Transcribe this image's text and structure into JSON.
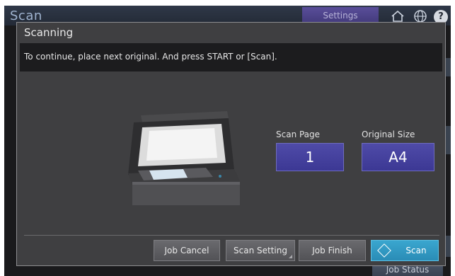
{
  "topbar": {
    "title": "Scan",
    "settings_label": "Settings",
    "icons": [
      "home-icon",
      "globe-icon",
      "help-icon"
    ],
    "help_glyph": "?"
  },
  "dialog": {
    "title": "Scanning",
    "message": "To continue, place next original. And press START or [Scan]."
  },
  "fields": {
    "scan_page_label": "Scan Page",
    "scan_page_value": "1",
    "original_size_label": "Original Size",
    "original_size_value": "A4"
  },
  "buttons": {
    "job_cancel": "Job Cancel",
    "scan_setting": "Scan Setting",
    "job_finish": "Job Finish",
    "scan": "Scan"
  },
  "footer": {
    "job_status": "Job Status"
  },
  "colors": {
    "accent": "#3c3894",
    "scan_button": "#2a8cb6",
    "dialog_bg": "#3f3f41"
  }
}
